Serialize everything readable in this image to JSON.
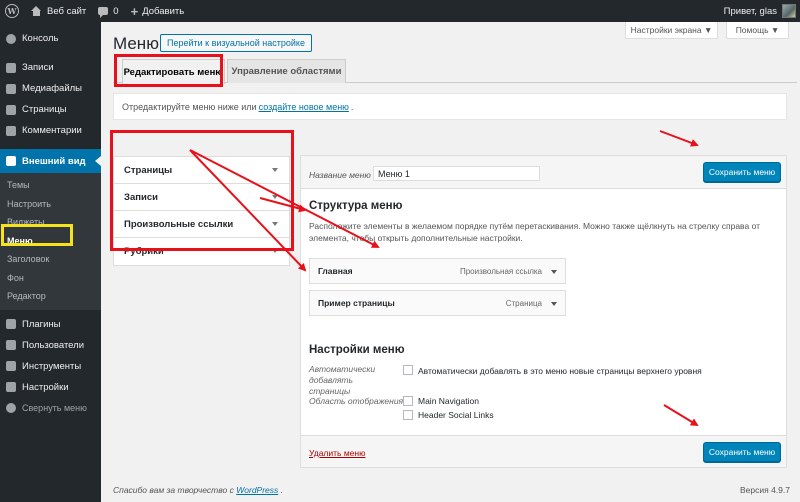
{
  "adminbar": {
    "site_name": "Веб сайт",
    "comments_count": "0",
    "add_new": "Добавить",
    "greeting": "Привет, glas"
  },
  "sidebar": {
    "items": [
      {
        "label": "Консоль",
        "icon": "dashboard-icon"
      },
      {
        "label": "Записи",
        "icon": "pin-icon"
      },
      {
        "label": "Медиафайлы",
        "icon": "media-icon"
      },
      {
        "label": "Страницы",
        "icon": "pages-icon"
      },
      {
        "label": "Комментарии",
        "icon": "comments-icon"
      },
      {
        "label": "Внешний вид",
        "icon": "appearance-icon"
      }
    ],
    "submenu": [
      "Темы",
      "Настроить",
      "Виджеты",
      "Меню",
      "Заголовок",
      "Фон",
      "Редактор"
    ],
    "items2": [
      {
        "label": "Плагины",
        "icon": "plugins-icon"
      },
      {
        "label": "Пользователи",
        "icon": "users-icon"
      },
      {
        "label": "Инструменты",
        "icon": "tools-icon"
      },
      {
        "label": "Настройки",
        "icon": "settings-icon"
      }
    ],
    "collapse": "Свернуть меню"
  },
  "screen_meta": {
    "screen_options": "Настройки экрана ▼",
    "help": "Помощь ▼"
  },
  "page": {
    "title": "Меню",
    "title_action": "Перейти к визуальной настройке"
  },
  "tabs": {
    "edit": "Редактировать меню",
    "locations": "Управление областями"
  },
  "notice": {
    "before": "Отредактируйте меню ниже или",
    "link": "создайте новое меню",
    "after": "."
  },
  "accordion": [
    "Страницы",
    "Записи",
    "Произвольные ссылки",
    "Рубрики"
  ],
  "menu_editor": {
    "name_label": "Название меню",
    "name_value": "Меню 1",
    "save_label": "Сохранить меню",
    "structure_title": "Структура меню",
    "structure_desc": "Расположите элементы в желаемом порядке путём перетаскивания. Можно также щёлкнуть на стрелку справа от элемента, чтобы открыть дополнительные настройки.",
    "items": [
      {
        "title": "Главная",
        "type": "Произвольная ссылка"
      },
      {
        "title": "Пример страницы",
        "type": "Страница"
      }
    ],
    "settings_title": "Настройки меню",
    "auto_add_label": "Автоматически добавлять страницы",
    "auto_add_text": "Автоматически добавлять в это меню новые страницы верхнего уровня",
    "locations_label": "Область отображения",
    "locations": [
      "Main Navigation",
      "Header Social Links"
    ],
    "delete_label": "Удалить меню"
  },
  "footer": {
    "thanks_before": "Спасибо вам за творчество с",
    "thanks_link": "WordPress",
    "thanks_after": ".",
    "version": "Версия 4.9.7"
  },
  "colors": {
    "adminbar": "#23282d",
    "accent": "#0073aa",
    "button": "#0085ba",
    "highlight_red": "#e8101a",
    "highlight_yellow": "#f5e41b"
  }
}
